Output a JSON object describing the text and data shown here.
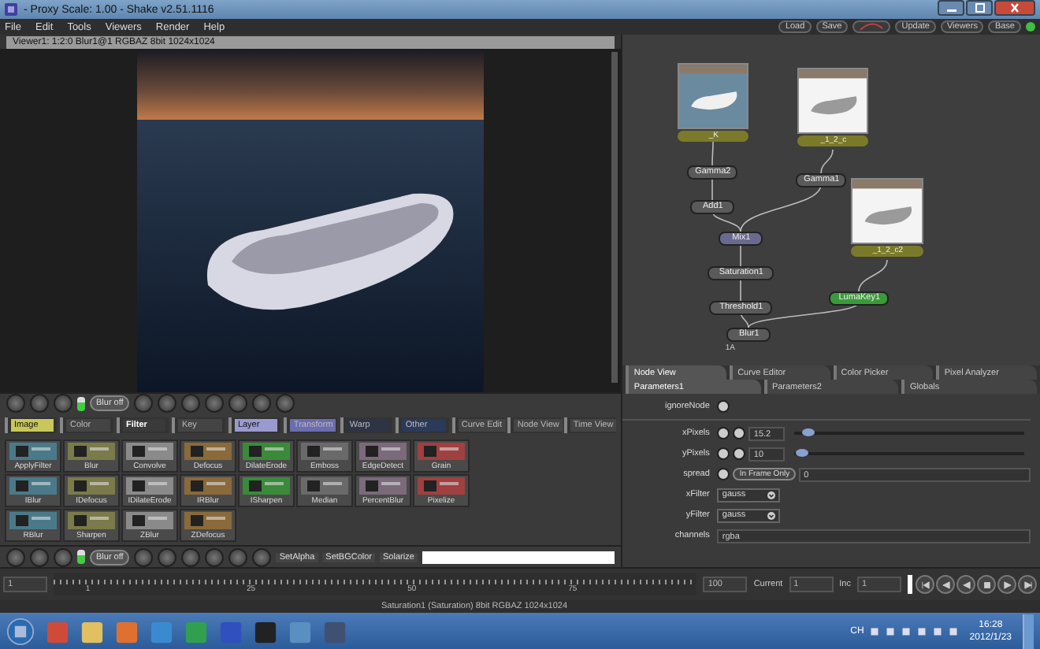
{
  "window": {
    "title": "- Proxy Scale: 1.00 - Shake v2.51.1116"
  },
  "menu": [
    "File",
    "Edit",
    "Tools",
    "Viewers",
    "Render",
    "Help"
  ],
  "top_buttons": [
    "Load",
    "Save",
    "Update",
    "Viewers",
    "Base"
  ],
  "viewer": {
    "header": "Viewer1: 1:2:0 Blur1@1 RGBAZ 8bit 1024x1024",
    "blur_button": "Blur off"
  },
  "tool_tabs": [
    {
      "label": "Image",
      "selected": false,
      "color": "#c8c85a"
    },
    {
      "label": "Color",
      "selected": false,
      "color": "#444444"
    },
    {
      "label": "Filter",
      "selected": true,
      "color": "#3a3a3a"
    },
    {
      "label": "Key",
      "selected": false,
      "color": "#444444"
    },
    {
      "label": "Layer",
      "selected": false,
      "color": "#9a9ad0"
    },
    {
      "label": "Transform",
      "selected": false,
      "color": "#6c6cb0"
    },
    {
      "label": "Warp",
      "selected": false,
      "color": "#2e3444"
    },
    {
      "label": "Other",
      "selected": false,
      "color": "#2a3a5a"
    },
    {
      "label": "Curve Edit",
      "selected": false,
      "color": "#444444"
    },
    {
      "label": "Node View",
      "selected": false,
      "color": "#444444"
    },
    {
      "label": "Time View",
      "selected": false,
      "color": "#444444"
    }
  ],
  "tools": [
    "ApplyFilter",
    "Blur",
    "Convolve",
    "Defocus",
    "DilateErode",
    "Emboss",
    "EdgeDetect",
    "Grain",
    "IBlur",
    "IDefocus",
    "IDilateErode",
    "IRBlur",
    "ISharpen",
    "Median",
    "PercentBlur",
    "Pixelize",
    "RBlur",
    "Sharpen",
    "ZBlur",
    "ZDefocus"
  ],
  "lower_toolbar": {
    "blur_button": "Blur off",
    "tools": [
      "SetAlpha",
      "SetBGColor",
      "Solarize"
    ]
  },
  "node_view": {
    "nodes": [
      {
        "kind": "thumbnail",
        "label": "_K",
        "color": "#7a7a2a"
      },
      {
        "kind": "thumbnail",
        "label": "_1_2_c",
        "color": "#7a7a2a"
      },
      {
        "kind": "node",
        "label": "Gamma2",
        "color": "#5a5a5a"
      },
      {
        "kind": "node",
        "label": "Gamma1",
        "color": "#5a5a5a"
      },
      {
        "kind": "node",
        "label": "Add1",
        "color": "#5a5a5a"
      },
      {
        "kind": "node",
        "label": "Mix1",
        "color": "#6a6a90"
      },
      {
        "kind": "thumbnail",
        "label": "_1_2_c2",
        "color": "#7a7a2a"
      },
      {
        "kind": "node",
        "label": "Saturation1",
        "color": "#5a5a5a"
      },
      {
        "kind": "node",
        "label": "LumaKey1",
        "color": "#3a9a3a"
      },
      {
        "kind": "node",
        "label": "Threshold1",
        "color": "#5a5a5a"
      },
      {
        "kind": "node",
        "label": "Blur1",
        "color": "#5a5a5a"
      }
    ],
    "note": "1A"
  },
  "panel_tabs": [
    {
      "label": "Node View",
      "selected": true
    },
    {
      "label": "Curve Editor",
      "selected": false
    },
    {
      "label": "Color Picker",
      "selected": false
    },
    {
      "label": "Pixel Analyzer",
      "selected": false
    }
  ],
  "param_tabs": [
    {
      "label": "Parameters1",
      "selected": true
    },
    {
      "label": "Parameters2",
      "selected": false
    },
    {
      "label": "Globals",
      "selected": false
    }
  ],
  "parameters": [
    {
      "kind": "toggle",
      "name": "ignoreNode"
    },
    {
      "kind": "slider",
      "name": "xPixels",
      "value": "15.2",
      "level": 0.06
    },
    {
      "kind": "slider",
      "name": "yPixels",
      "value": "10",
      "level": 0.03
    },
    {
      "kind": "option",
      "name": "spread",
      "button": "In Frame Only",
      "value": "0"
    },
    {
      "kind": "menu",
      "name": "xFilter",
      "value": "gauss"
    },
    {
      "kind": "menu",
      "name": "yFilter",
      "value": "gauss"
    },
    {
      "kind": "text",
      "name": "channels",
      "value": "rgba"
    }
  ],
  "timeline": {
    "start": "1",
    "tick_labels": [
      "1",
      "25",
      "50",
      "75"
    ],
    "end": "100",
    "current_label": "Current",
    "current": "1",
    "inc_label": "Inc",
    "inc": "1"
  },
  "status_bar": "Saturation1 (Saturation) 8bit RGBAZ 1024x1024",
  "taskbar": {
    "language": "CH",
    "time": "16:28",
    "date": "2012/1/23"
  }
}
